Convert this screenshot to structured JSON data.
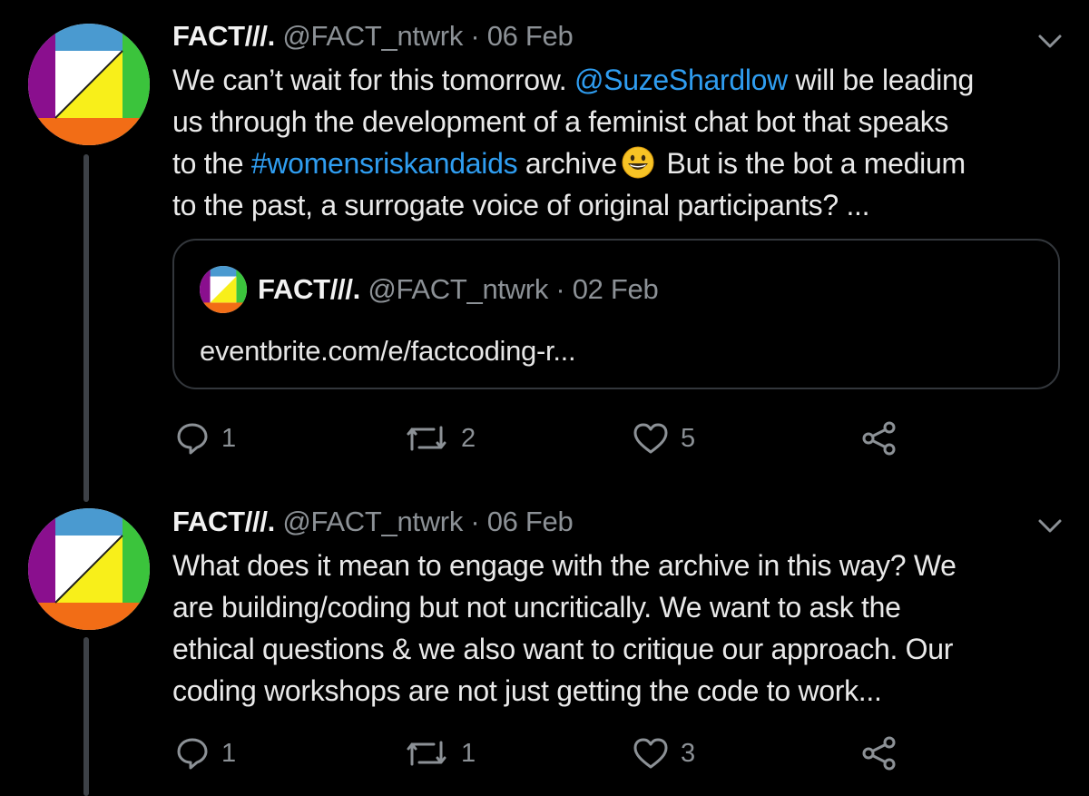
{
  "colors": {
    "background": "#000000",
    "text": "#e9e9e9",
    "secondary": "#8c9196",
    "link": "#2f9df0",
    "thread_line": "#3d4147"
  },
  "tweets": [
    {
      "avatar_icon": "fact-logo-avatar",
      "display_name": "FACT///.",
      "handle": "@FACT_ntwrk",
      "separator": "·",
      "date": "06 Feb",
      "body": {
        "line1_a": "We can’t wait for this tomorrow. ",
        "mention": "@SuzeShardlow",
        "line1_b": " will be leading",
        "line2": "us through the development of a feminist chat bot that speaks",
        "line3_a": "to the ",
        "hashtag": "#womensriskandaids",
        "line3_b": " archive",
        "emoji": "grinning-face-emoji",
        "line3_c": " But is the bot a medium",
        "line4": "to the past, a surrogate voice of original participants? ..."
      },
      "quote": {
        "avatar_icon": "fact-logo-avatar",
        "display_name": "FACT///.",
        "handle": "@FACT_ntwrk",
        "separator": "·",
        "date": "02 Feb",
        "text": "eventbrite.com/e/factcoding-r..."
      },
      "actions": {
        "reply_count": "1",
        "retweet_count": "2",
        "like_count": "5"
      }
    },
    {
      "avatar_icon": "fact-logo-avatar",
      "display_name": "FACT///.",
      "handle": "@FACT_ntwrk",
      "separator": "·",
      "date": "06 Feb",
      "body": {
        "line1": "What does it mean to engage with the archive in this way? We",
        "line2": "are building/coding but not uncritically. We want to ask the",
        "line3": "ethical questions & we also want to critique our approach. Our",
        "line4": "coding workshops are not just getting the code to work..."
      },
      "actions": {
        "reply_count": "1",
        "retweet_count": "1",
        "like_count": "3"
      }
    }
  ]
}
